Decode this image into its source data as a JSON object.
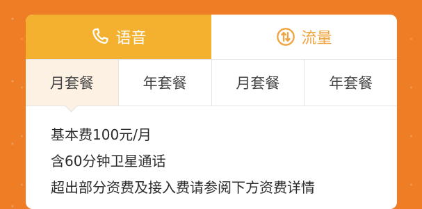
{
  "main_tabs": [
    {
      "label": "语音",
      "icon": "phone-icon"
    },
    {
      "label": "流量",
      "icon": "data-transfer-icon"
    }
  ],
  "sub_tabs": [
    {
      "label": "月套餐"
    },
    {
      "label": "年套餐"
    },
    {
      "label": "月套餐"
    },
    {
      "label": "年套餐"
    }
  ],
  "details": {
    "lines": [
      "基本费100元/月",
      "含60分钟卫星通话",
      "超出部分资费及接入费请参阅下方资费详情"
    ]
  },
  "colors": {
    "background": "#ee7d25",
    "active_tab": "#f3b12f",
    "inactive_tab_text": "#f1a33d",
    "active_subtab_bg": "#fdf1e3"
  }
}
